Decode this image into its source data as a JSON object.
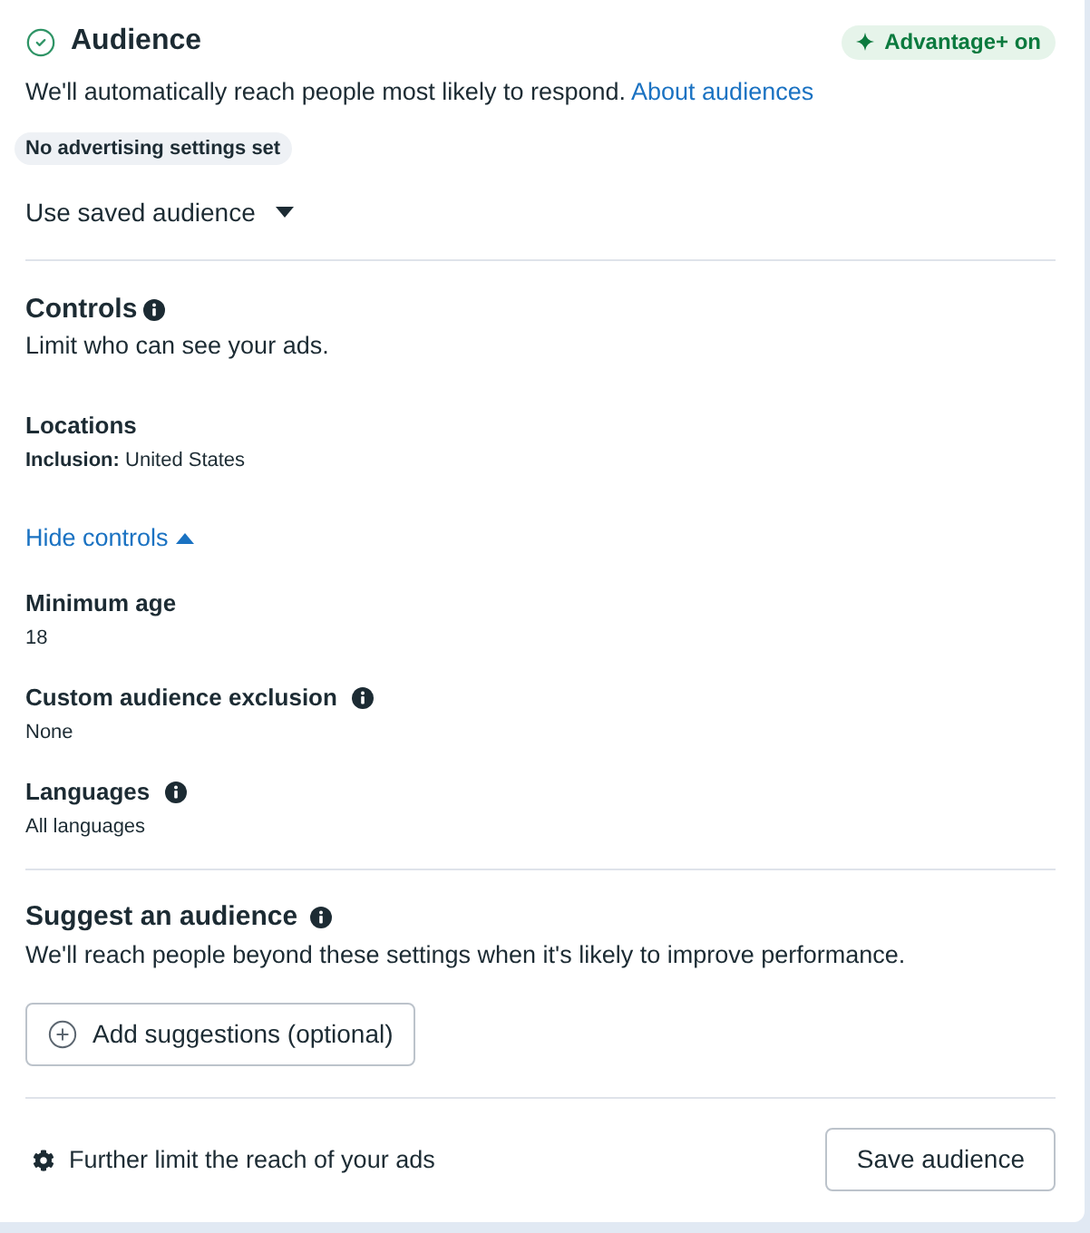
{
  "header": {
    "title": "Audience",
    "completed": true,
    "badge": "Advantage+ on"
  },
  "description": {
    "text": "We'll automatically reach people most likely to respond.",
    "link": "About audiences"
  },
  "status_pill": "No advertising settings set",
  "saved_audience_dropdown": {
    "label": "Use saved audience"
  },
  "controls": {
    "title": "Controls",
    "info": true,
    "subtitle": "Limit who can see your ads.",
    "fields": [
      {
        "label": "Locations",
        "value": "**Inclusion:** United States",
        "info": false
      }
    ],
    "toggle": {
      "label": "Hide controls",
      "expanded": true
    },
    "more_fields": [
      {
        "label": "Minimum age",
        "value": "18",
        "info": false
      },
      {
        "label": "Custom audience exclusion",
        "value": "None",
        "info": true
      },
      {
        "label": "Languages",
        "value": "All languages",
        "info": true
      }
    ]
  },
  "suggest": {
    "title": "Suggest an audience",
    "info": true,
    "description": "We'll reach people beyond these settings when it's likely to improve performance.",
    "button": "Add suggestions (optional)"
  },
  "footer": {
    "link": "Further limit the reach of your ads",
    "button": "Save audience"
  }
}
